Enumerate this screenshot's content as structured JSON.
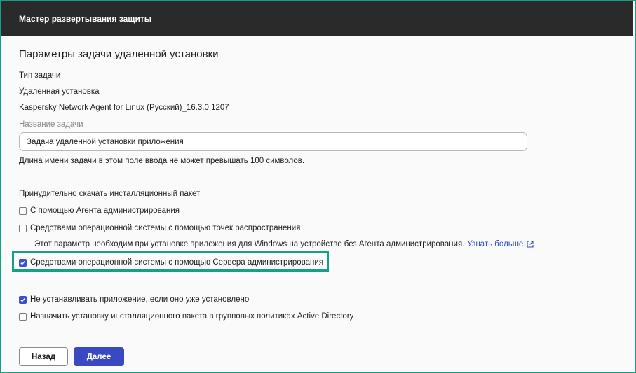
{
  "window": {
    "title": "Мастер развертывания защиты"
  },
  "main": {
    "heading": "Параметры задачи удаленной установки",
    "task_type_label": "Тип задачи",
    "task_type_value": "Удаленная установка",
    "package": "Kaspersky Network Agent for Linux (Русский)_16.3.0.1207",
    "task_name_label": "Название задачи",
    "task_name_value": "Задача удаленной установки приложения",
    "task_name_hint": "Длина имени задачи в этом поле ввода не может превышать 100 символов.",
    "force_download_label": "Принудительно скачать инсталляционный пакет",
    "options": [
      {
        "label": "С помощью Агента администрирования",
        "checked": false
      },
      {
        "label": "Средствами операционной системы с помощью точек распространения",
        "checked": false
      },
      {
        "label": "Средствами операционной системы с помощью Сервера администрирования",
        "checked": true
      }
    ],
    "distribution_note": "Этот параметр необходим при установке приложения для Windows на устройство без Агента администрирования.",
    "learn_more_link": "Узнать больше",
    "extra_options": [
      {
        "label": "Не устанавливать приложение, если оно уже установлено",
        "checked": true
      },
      {
        "label": "Назначить установку инсталляционного пакета в групповых политиках Active Directory",
        "checked": false
      }
    ]
  },
  "footer": {
    "back_label": "Назад",
    "next_label": "Далее"
  },
  "colors": {
    "accent": "#3a48c2",
    "highlight": "#16a085",
    "titlebar": "#2a2a2a",
    "link": "#2f4bd1"
  },
  "icons": {
    "checkbox_checked": "check-icon",
    "external_link": "external-link-icon"
  }
}
